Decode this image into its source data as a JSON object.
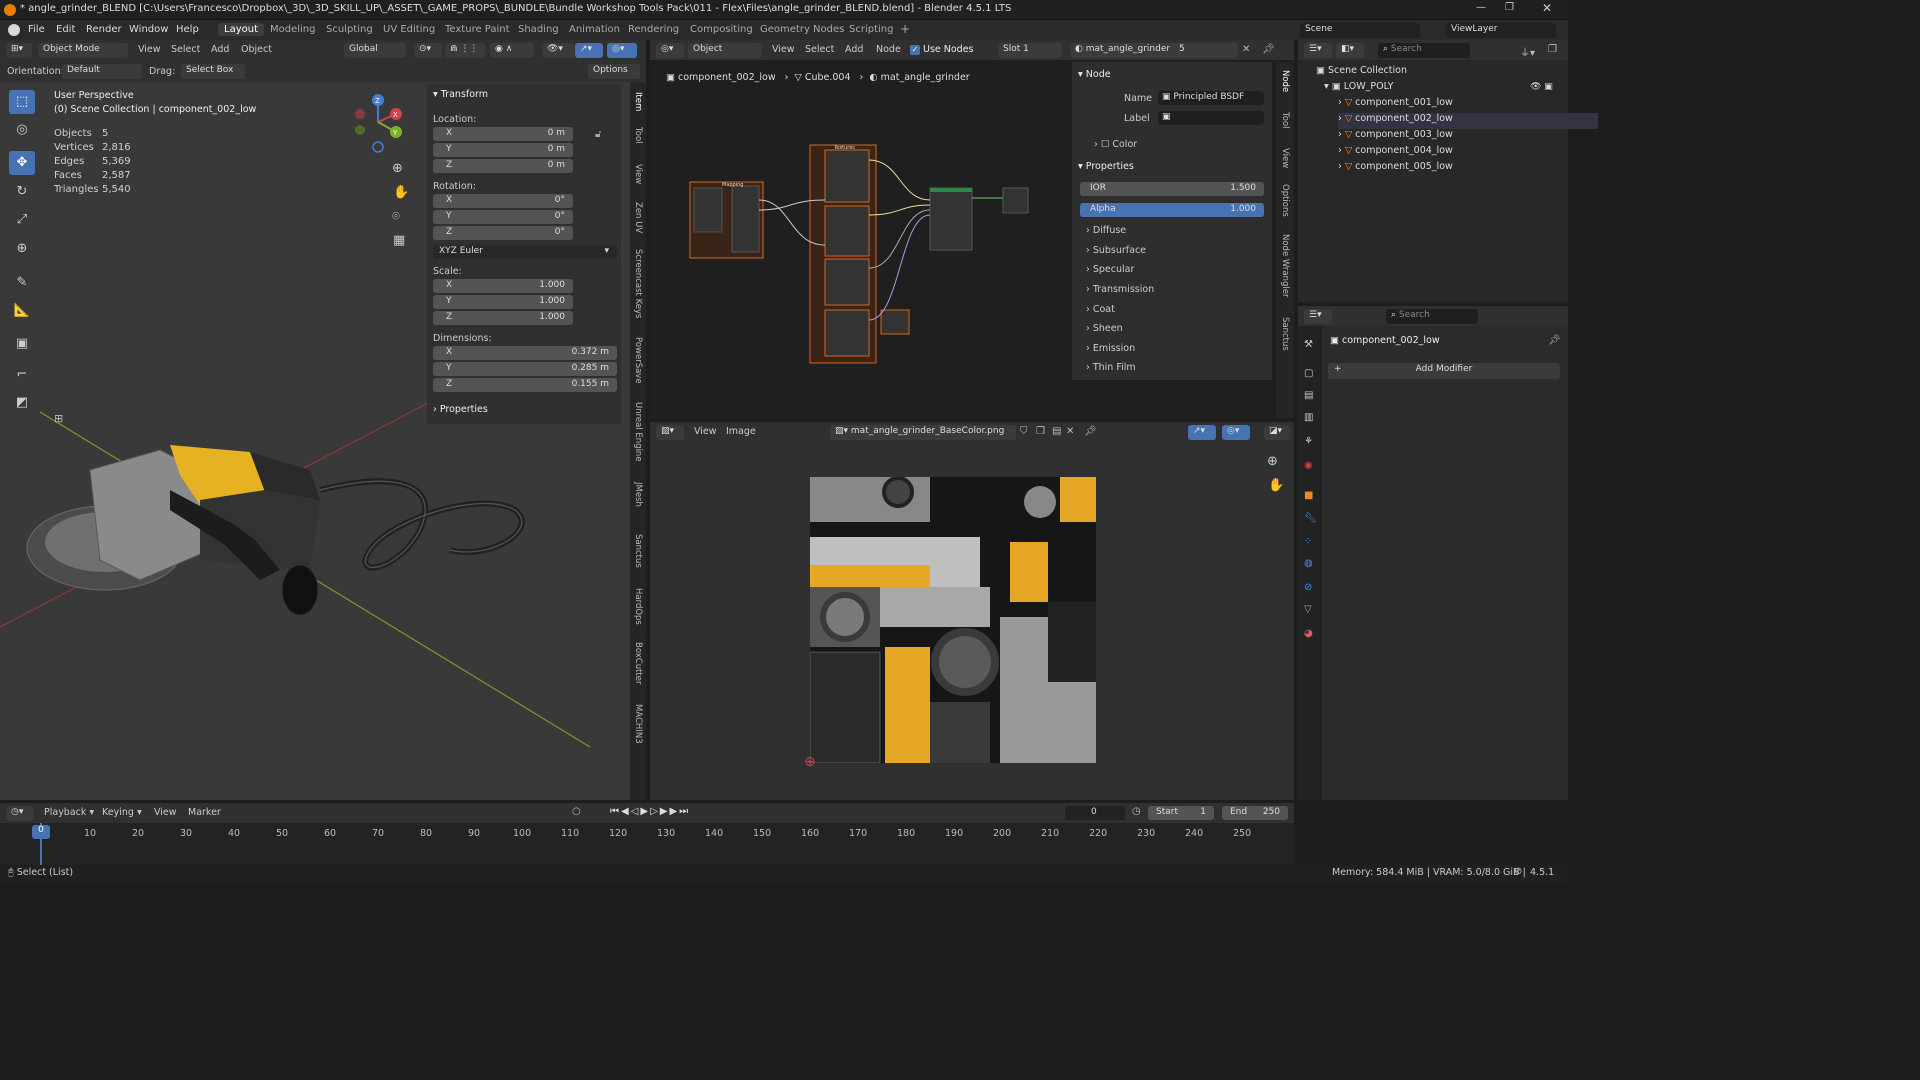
{
  "window": {
    "title": "* angle_grinder_BLEND [C:\\Users\\Francesco\\Dropbox\\_3D\\_3D_SKILL_UP\\_ASSET\\_GAME_PROPS\\_BUNDLE\\Bundle Workshop Tools Pack\\011 - Flex\\Files\\angle_grinder_BLEND.blend] - Blender 4.5.1 LTS"
  },
  "menu": [
    "File",
    "Edit",
    "Render",
    "Window",
    "Help"
  ],
  "workspaces": [
    "Layout",
    "Modeling",
    "Sculpting",
    "UV Editing",
    "Texture Paint",
    "Shading",
    "Animation",
    "Rendering",
    "Compositing",
    "Geometry Nodes",
    "Scripting"
  ],
  "scene": {
    "label": "Scene",
    "viewlayer": "ViewLayer"
  },
  "viewport": {
    "mode": "Object Mode",
    "menus": [
      "View",
      "Select",
      "Add",
      "Object"
    ],
    "transform_space": "Global",
    "orientation_label": "Orientation:",
    "orientation_value": "Default",
    "drag_label": "Drag:",
    "drag_value": "Select Box",
    "options": "Options",
    "view_name": "User Perspective",
    "collection": "(0) Scene Collection | component_002_low",
    "stats": [
      {
        "k": "Objects",
        "v": "5"
      },
      {
        "k": "Vertices",
        "v": "2,816"
      },
      {
        "k": "Edges",
        "v": "5,369"
      },
      {
        "k": "Faces",
        "v": "2,587"
      },
      {
        "k": "Triangles",
        "v": "5,540"
      }
    ]
  },
  "npanel": {
    "transform": "Transform",
    "location_label": "Location:",
    "location": [
      {
        "k": "X",
        "v": "0 m"
      },
      {
        "k": "Y",
        "v": "0 m"
      },
      {
        "k": "Z",
        "v": "0 m"
      }
    ],
    "rotation_label": "Rotation:",
    "rotation": [
      {
        "k": "X",
        "v": "0°"
      },
      {
        "k": "Y",
        "v": "0°"
      },
      {
        "k": "Z",
        "v": "0°"
      }
    ],
    "rotation_mode": "XYZ Euler",
    "scale_label": "Scale:",
    "scale": [
      {
        "k": "X",
        "v": "1.000"
      },
      {
        "k": "Y",
        "v": "1.000"
      },
      {
        "k": "Z",
        "v": "1.000"
      }
    ],
    "dimensions_label": "Dimensions:",
    "dimensions": [
      {
        "k": "X",
        "v": "0.372 m"
      },
      {
        "k": "Y",
        "v": "0.285 m"
      },
      {
        "k": "Z",
        "v": "0.155 m"
      }
    ],
    "properties": "Properties",
    "tabs": [
      "Item",
      "Tool",
      "View",
      "Zen UV",
      "Screencast Keys",
      "PowerSave",
      "Unreal Engine",
      "JMesh",
      "Sanctus",
      "HardOps",
      "BoxCutter",
      "MACHIN3"
    ]
  },
  "node_editor": {
    "object": "Object",
    "menus": [
      "View",
      "Select",
      "Add",
      "Node"
    ],
    "use_nodes": "Use Nodes",
    "slot": "Slot 1",
    "material": "mat_angle_grinder",
    "users": "5",
    "breadcrumb": [
      "component_002_low",
      "Cube.004",
      "mat_angle_grinder"
    ],
    "frames": [
      "Mapping",
      "Textures"
    ],
    "node_panel": {
      "node": "Node",
      "name_label": "Name",
      "name_value": "Principled BSDF",
      "label_label": "Label",
      "color": "Color",
      "properties": "Properties",
      "ior_label": "IOR",
      "ior": "1.500",
      "alpha_label": "Alpha",
      "alpha": "1.000",
      "sections": [
        "Diffuse",
        "Subsurface",
        "Specular",
        "Transmission",
        "Coat",
        "Sheen",
        "Emission",
        "Thin Film"
      ]
    },
    "tabs": [
      "Node",
      "Tool",
      "View",
      "Options",
      "Node Wrangler",
      "Sanctus"
    ]
  },
  "image_editor": {
    "menus": [
      "View",
      "Image"
    ],
    "image": "mat_angle_grinder_BaseColor.png"
  },
  "outliner": {
    "search": "Search",
    "root": "Scene Collection",
    "collection": "LOW_POLY",
    "items": [
      "component_001_low",
      "component_002_low",
      "component_003_low",
      "component_004_low",
      "component_005_low"
    ]
  },
  "properties": {
    "search": "Search",
    "object": "component_002_low",
    "add_modifier": "Add Modifier"
  },
  "timeline": {
    "menus": [
      "Playback",
      "Keying",
      "View",
      "Marker"
    ],
    "current": "0",
    "start_label": "Start",
    "start": "1",
    "end_label": "End",
    "end": "250",
    "ticks": [
      "0",
      "10",
      "20",
      "30",
      "40",
      "50",
      "60",
      "70",
      "80",
      "90",
      "100",
      "110",
      "120",
      "130",
      "140",
      "150",
      "160",
      "170",
      "180",
      "190",
      "200",
      "210",
      "220",
      "230",
      "240",
      "250"
    ]
  },
  "status": {
    "left": "Select (List)",
    "right": "Memory: 584.4 MiB | VRAM: 5.0/8.0 GiB |",
    "version": "4.5.1"
  },
  "colors": {
    "accent": "#4772b3",
    "yellow": "#f0b32a",
    "header": "#303030",
    "bg": "#1d1d1d"
  }
}
